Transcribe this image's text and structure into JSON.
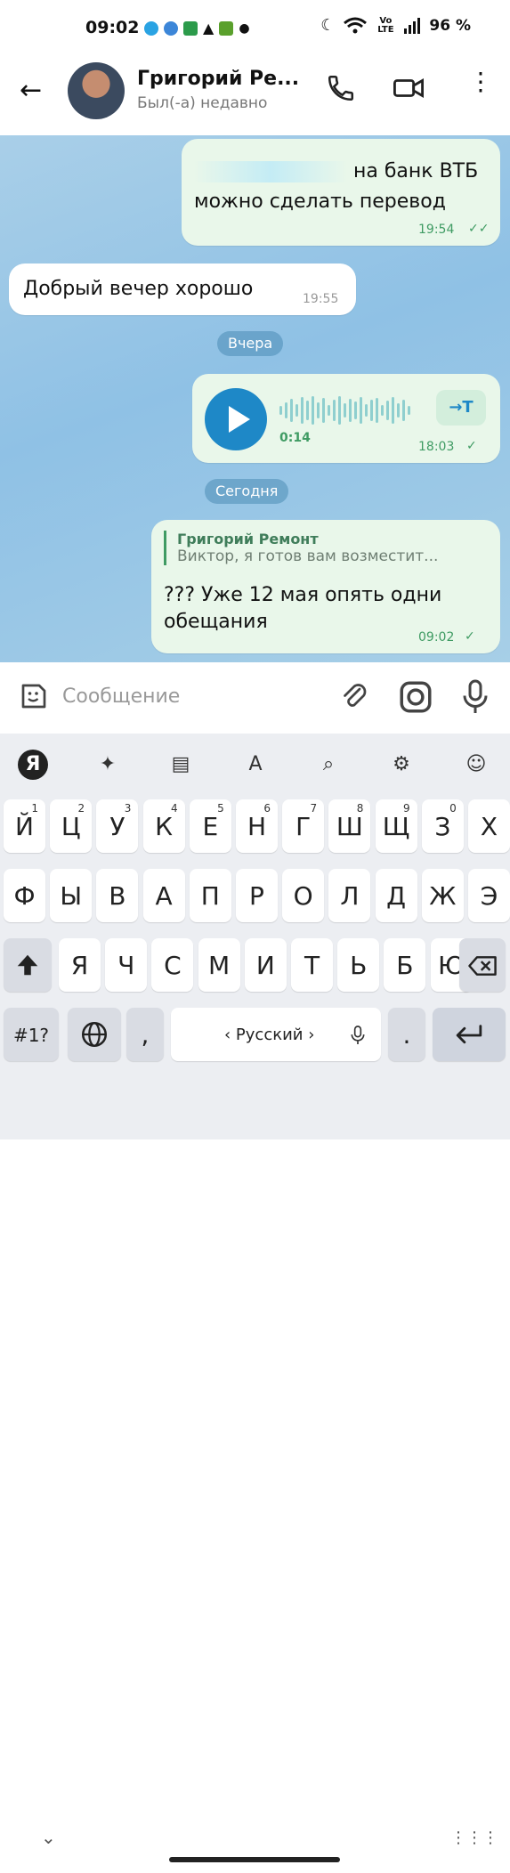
{
  "status_bar": {
    "time": "09:02",
    "battery": "96 %",
    "volte": "Vo LTE"
  },
  "header": {
    "contact_name": "Григорий Ре...",
    "last_seen": "Был(-а) недавно"
  },
  "messages": [
    {
      "text_line1": "на банк ВТБ",
      "text_line2": "можно сделать перевод",
      "time": "19:54",
      "read": "✓✓"
    },
    {
      "text": "Добрый вечер хорошо",
      "time": "19:55"
    },
    {
      "date_pill": "Вчера"
    },
    {
      "voice_duration": "0:14",
      "transcribe_label": "→T",
      "time": "18:03",
      "read": "✓"
    },
    {
      "date_pill": "Сегодня"
    },
    {
      "reply_name": "Григорий Ремонт",
      "reply_text": "Виктор, я готов вам возместит...",
      "text_line1": "??? Уже 12 мая опять одни",
      "text_line2": "обещания",
      "time": "09:02",
      "read": "✓"
    }
  ],
  "composer": {
    "placeholder": "Сообщение"
  },
  "keyboard": {
    "row1": [
      "Й",
      "Ц",
      "У",
      "К",
      "Е",
      "Н",
      "Г",
      "Ш",
      "Щ",
      "З",
      "Х"
    ],
    "row1_hints": [
      "1",
      "2",
      "3",
      "4",
      "5",
      "6",
      "7",
      "8",
      "9",
      "0",
      ""
    ],
    "row2": [
      "Ф",
      "Ы",
      "В",
      "А",
      "П",
      "Р",
      "О",
      "Л",
      "Д",
      "Ж",
      "Э"
    ],
    "row3": [
      "Я",
      "Ч",
      "С",
      "М",
      "И",
      "Т",
      "Ь",
      "Б",
      "Ю"
    ],
    "symbols_key": "#1?",
    "comma": ",",
    "space_label": "‹ Русский ›",
    "period": "."
  },
  "icons": [
    "back-arrow-icon",
    "phone-icon",
    "video-icon",
    "more-icon",
    "sticker-icon",
    "paperclip-icon",
    "camera-icon",
    "mic-icon",
    "yandex-icon",
    "magic-wand-icon",
    "clipboard-icon",
    "translate-icon",
    "search-icon",
    "gear-icon",
    "smile-icon",
    "shift-icon",
    "backspace-icon",
    "globe-icon",
    "enter-icon",
    "chevron-down-icon",
    "keyboard-grid-icon"
  ],
  "colors": {
    "accent": "#1e88c7",
    "outgoing_bubble": "#e9f7ea",
    "chat_bg": "#8fc1e5",
    "read_check": "#3f9b63"
  }
}
